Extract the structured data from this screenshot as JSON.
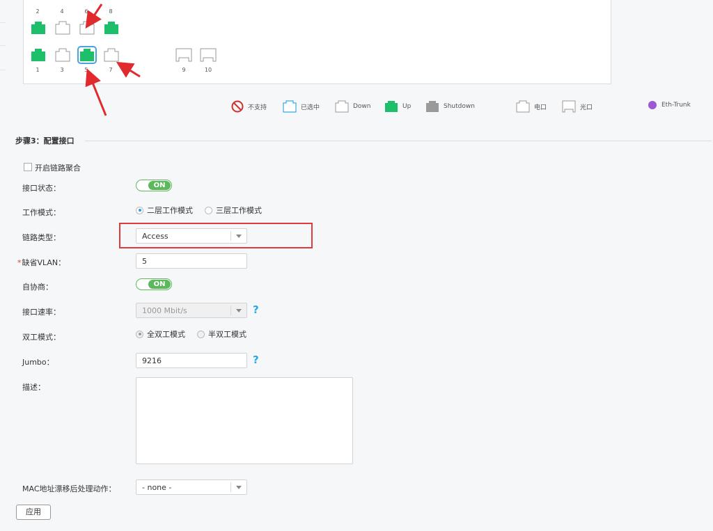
{
  "port_panel": {
    "top_row": [
      {
        "num": "2",
        "state": "up"
      },
      {
        "num": "4",
        "state": "down"
      },
      {
        "num": "6",
        "state": "down"
      },
      {
        "num": "8",
        "state": "up"
      }
    ],
    "bottom_row": [
      {
        "num": "1",
        "state": "up"
      },
      {
        "num": "3",
        "state": "down"
      },
      {
        "num": "5",
        "state": "selected-up"
      },
      {
        "num": "7",
        "state": "down"
      }
    ],
    "optical_ports": [
      {
        "num": "9"
      },
      {
        "num": "10"
      }
    ]
  },
  "legend": {
    "unsupported": "不支持",
    "selected": "已选中",
    "down": "Down",
    "up": "Up",
    "shutdown": "Shutdown",
    "electrical": "电口",
    "optical": "光口",
    "eth_trunk": "Eth-Trunk"
  },
  "colors": {
    "up": "#1dbf6b",
    "shutdown": "#9a9a9a",
    "selected": "#3aa8e0",
    "unsupported": "#d0302f",
    "eth_trunk": "#9b59d6",
    "annotation": "#e02a2e",
    "toggle_on": "#5cb85c"
  },
  "form": {
    "section_title": "步骤3：配置接口",
    "enable_link_agg": "开启链路聚合",
    "port_status": {
      "label": "接口状态：",
      "value": "ON"
    },
    "work_mode": {
      "label": "工作模式：",
      "options": [
        "二层工作模式",
        "三层工作模式"
      ],
      "selected": "二层工作模式"
    },
    "link_type": {
      "label": "链路类型：",
      "value": "Access"
    },
    "default_vlan": {
      "label": "缺省VLAN：",
      "required_mark": "*",
      "value": "5"
    },
    "auto_neg": {
      "label": "自协商：",
      "value": "ON"
    },
    "port_speed": {
      "label": "接口速率：",
      "value": "1000 Mbit/s",
      "help": "?"
    },
    "duplex": {
      "label": "双工模式：",
      "options": [
        "全双工模式",
        "半双工模式"
      ],
      "selected": "全双工模式"
    },
    "jumbo": {
      "label": "Jumbo：",
      "value": "9216",
      "help": "?"
    },
    "description": {
      "label": "描述：",
      "value": ""
    },
    "mac_action": {
      "label": "MAC地址漂移后处理动作：",
      "value": "- none -"
    },
    "apply_button": "应用"
  }
}
